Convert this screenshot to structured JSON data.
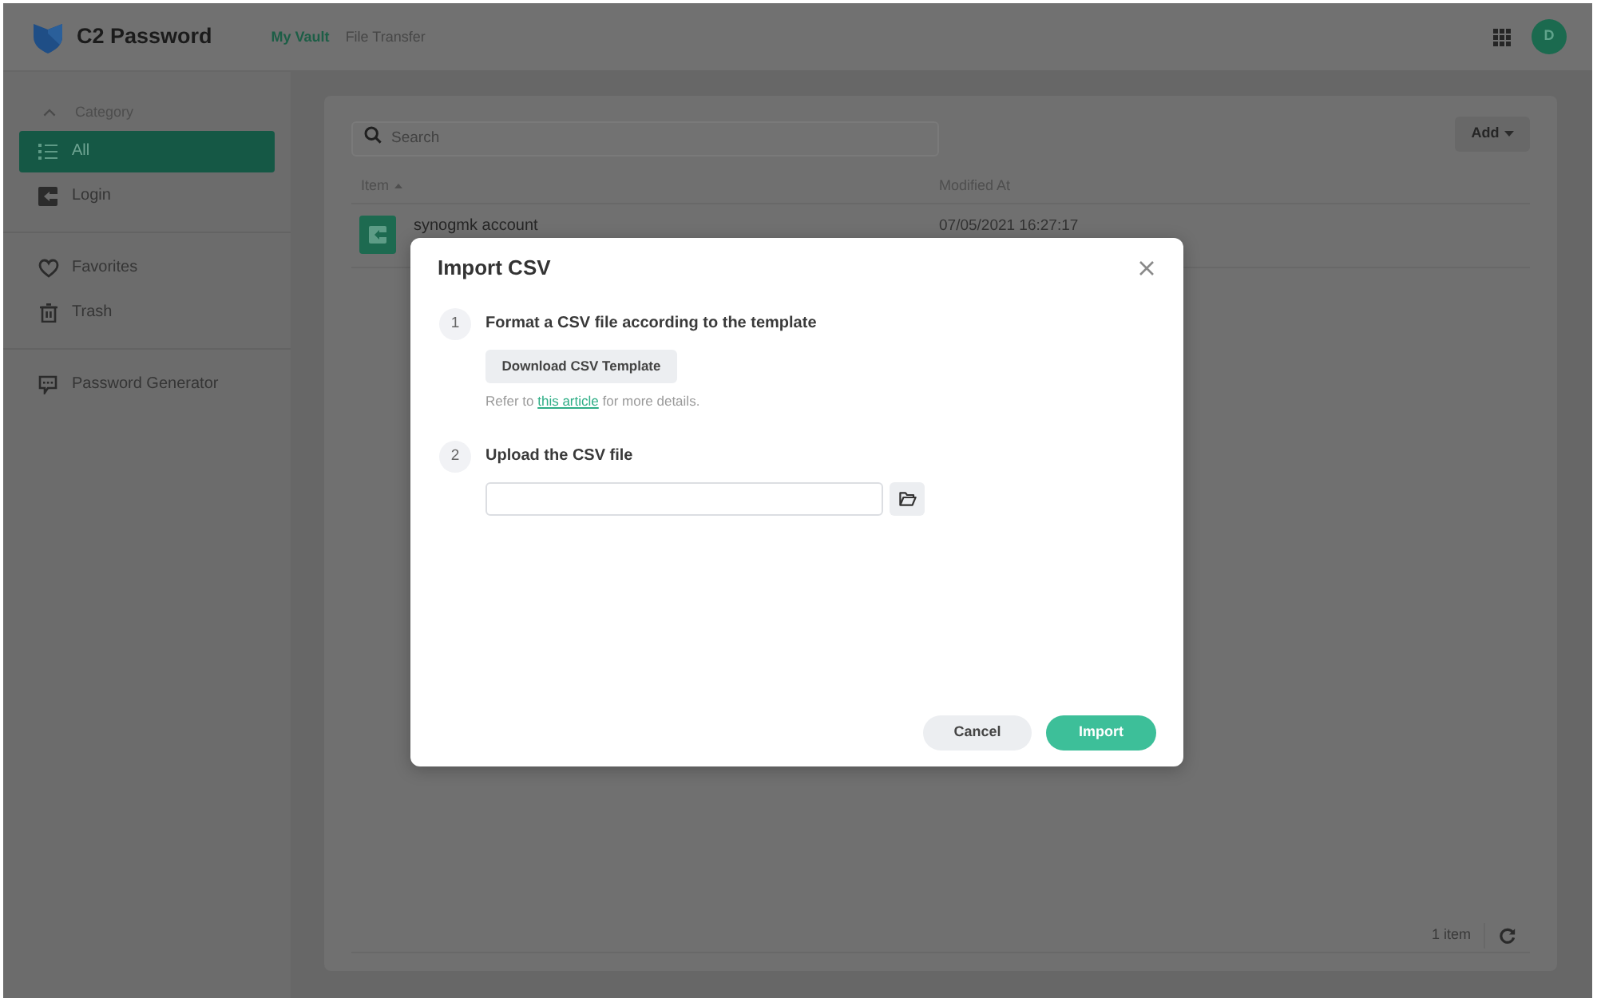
{
  "app": {
    "name": "C2 Password"
  },
  "nav_tabs": [
    {
      "label": "My Vault",
      "selected": true
    },
    {
      "label": "File Transfer",
      "selected": false
    }
  ],
  "user": {
    "initial": "D"
  },
  "sidebar": {
    "category": {
      "label": "Category",
      "expanded": true
    },
    "groups": [
      [
        {
          "label": "All",
          "kind": "list",
          "selected": true
        },
        {
          "label": "Login",
          "kind": "login",
          "selected": false
        }
      ],
      [
        {
          "label": "Favorites",
          "kind": "heart",
          "selected": false
        },
        {
          "label": "Trash",
          "kind": "trash",
          "selected": false
        }
      ],
      [
        {
          "label": "Password Generator",
          "kind": "generator",
          "selected": false
        }
      ]
    ]
  },
  "search": {
    "placeholder": "Search"
  },
  "add_button": {
    "label": "Add"
  },
  "table": {
    "columns": [
      {
        "label": "Item",
        "sorted": true
      },
      {
        "label": "Modified At",
        "sorted": false
      }
    ],
    "rows": [
      {
        "name": "synogmk account",
        "modified": "07/05/2021 16:27:17"
      }
    ]
  },
  "footer": {
    "count": "1 item"
  },
  "dialog": {
    "title": "Import CSV",
    "steps": [
      {
        "number": "1",
        "title": "Format a CSV file according to the template",
        "kind": "download",
        "button": "Download CSV Template",
        "note": {
          "before": "Refer to",
          "link": "this article",
          "after": "for more details."
        }
      },
      {
        "number": "2",
        "title": "Upload the CSV file",
        "kind": "upload"
      }
    ],
    "buttons": [
      {
        "label": "Cancel",
        "kind": "secondary"
      },
      {
        "label": "Import",
        "kind": "primary"
      }
    ]
  }
}
